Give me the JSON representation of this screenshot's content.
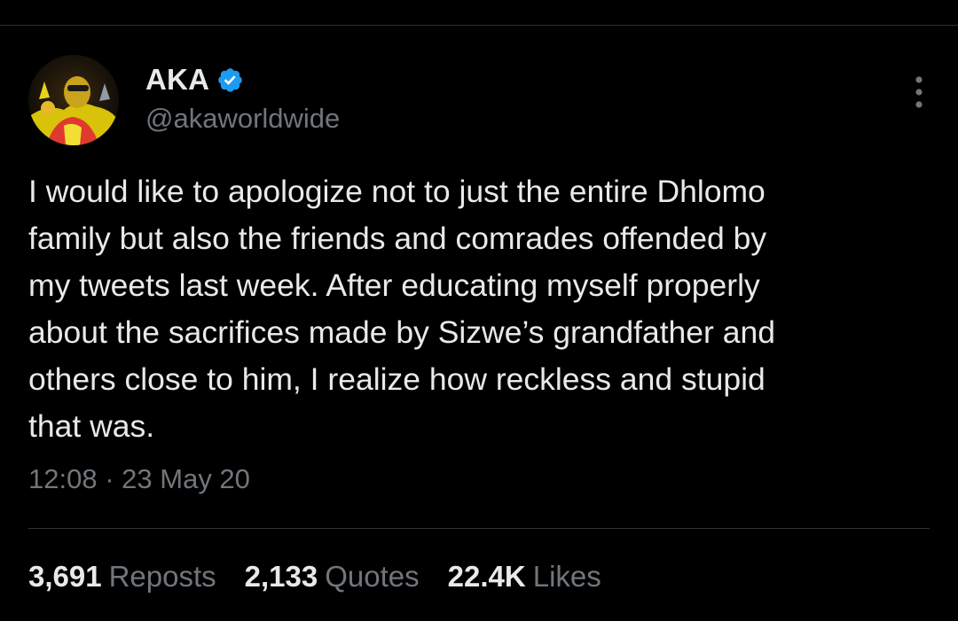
{
  "author": {
    "display_name": "AKA",
    "handle": "@akaworldwide",
    "verified": true,
    "avatar_icon": "profile-photo"
  },
  "tweet": {
    "text_lines": [
      "I would like to apologize not to just the entire Dhlomo",
      "family but also the friends and comrades offended by",
      "my tweets last week. After educating myself properly",
      "about the sacrifices made by Sizwe’s grandfather and",
      "others close to him, I realize how reckless and stupid",
      "that was."
    ],
    "time": "12:08",
    "separator": "·",
    "date": "23 May 20"
  },
  "stats": [
    {
      "value": "3,691",
      "label": "Reposts"
    },
    {
      "value": "2,133",
      "label": "Quotes"
    },
    {
      "value": "22.4K",
      "label": "Likes"
    }
  ],
  "icons": {
    "more": "more-vertical-icon",
    "verified": "verified-badge-icon"
  },
  "colors": {
    "background": "#000000",
    "primary_text": "#e7e9ea",
    "secondary_text": "#71767b",
    "divider": "#2f3336",
    "verified_blue": "#1d9bf0"
  }
}
